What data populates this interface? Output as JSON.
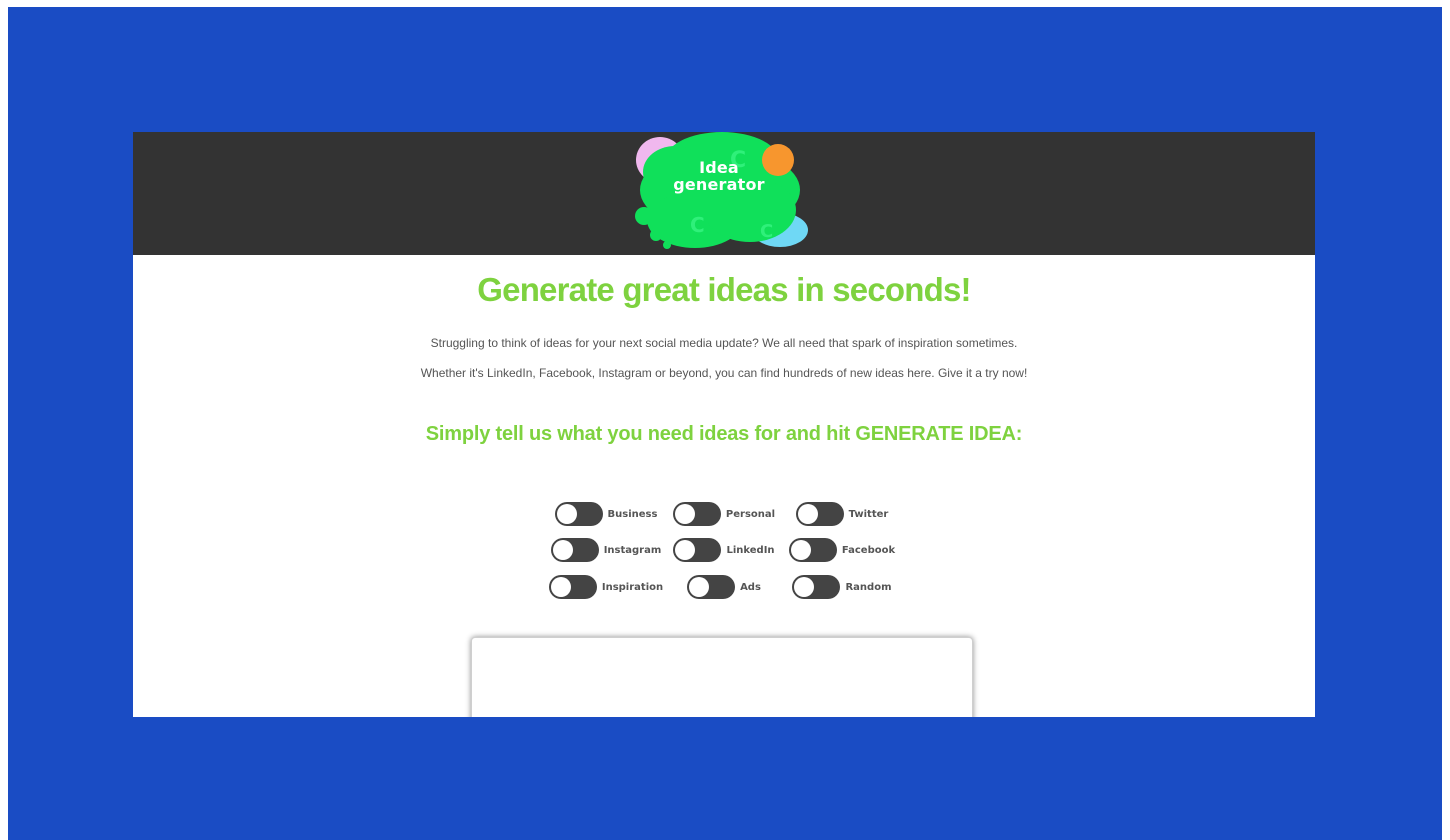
{
  "logo": {
    "line1": "Idea",
    "line2": "generator"
  },
  "hero": {
    "headline": "Generate great ideas in seconds!",
    "intro_line1": "Struggling to think of ideas for your next social media update? We all need that spark of inspiration sometimes.",
    "intro_line2": "Whether it's LinkedIn, Facebook, Instagram or beyond, you can find hundreds of new ideas here. Give it a try now!"
  },
  "instructions": "Simply tell us what you need ideas for and hit GENERATE IDEA:",
  "toggles": [
    {
      "label": "Business",
      "on": false
    },
    {
      "label": "Personal",
      "on": false
    },
    {
      "label": "Twitter",
      "on": false
    },
    {
      "label": "Instagram",
      "on": false
    },
    {
      "label": "LinkedIn",
      "on": false
    },
    {
      "label": "Facebook",
      "on": false
    },
    {
      "label": "Inspiration",
      "on": false
    },
    {
      "label": "Ads",
      "on": false
    },
    {
      "label": "Random",
      "on": false
    }
  ],
  "colors": {
    "backdrop": "#1a4cc4",
    "header": "#333333",
    "accent_green": "#7ed23f",
    "logo_green": "#10e05a",
    "logo_pink": "#f0b8ee",
    "logo_orange": "#f7962e",
    "logo_blue": "#6fd8f5",
    "toggle_off": "#444444"
  }
}
